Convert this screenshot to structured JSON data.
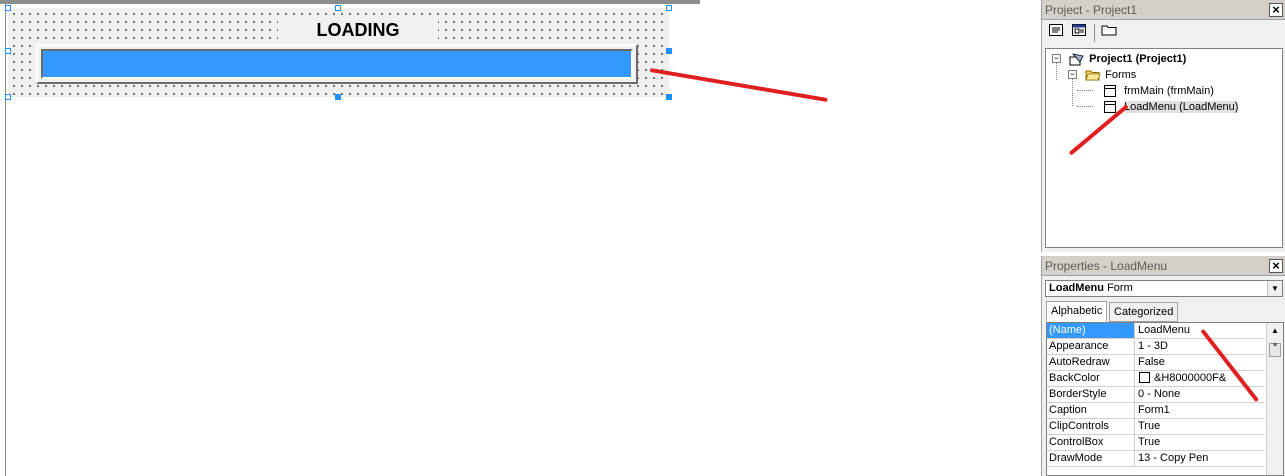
{
  "designer": {
    "form_title": "LOADING",
    "progress_fraction": 1.0,
    "progress_color": "#3399ff"
  },
  "project_pane": {
    "title": "Project - Project1",
    "close_icon": "×",
    "toolbar_icons": [
      "view-code-icon",
      "view-object-icon",
      "toggle-folders-icon"
    ],
    "tree": {
      "project_label": "Project1 (Project1)",
      "folder_label": "Forms",
      "items": [
        "frmMain (frmMain)",
        "LoadMenu (LoadMenu)"
      ]
    }
  },
  "properties_pane": {
    "title": "Properties - LoadMenu",
    "close_icon": "×",
    "object_name": "LoadMenu",
    "object_type": "Form",
    "tabs": [
      "Alphabetic",
      "Categorized"
    ],
    "active_tab": "Alphabetic",
    "rows": [
      {
        "name": "(Name)",
        "value": "LoadMenu"
      },
      {
        "name": "Appearance",
        "value": "1 - 3D"
      },
      {
        "name": "AutoRedraw",
        "value": "False"
      },
      {
        "name": "BackColor",
        "value": "&H8000000F&"
      },
      {
        "name": "BorderStyle",
        "value": "0 - None"
      },
      {
        "name": "Caption",
        "value": "Form1"
      },
      {
        "name": "ClipControls",
        "value": "True"
      },
      {
        "name": "ControlBox",
        "value": "True"
      },
      {
        "name": "DrawMode",
        "value": "13 - Copy Pen"
      }
    ]
  },
  "colors": {
    "annotation_stroke": "#e02020",
    "selection": "#3399ff",
    "handle": "#1e90ff"
  }
}
